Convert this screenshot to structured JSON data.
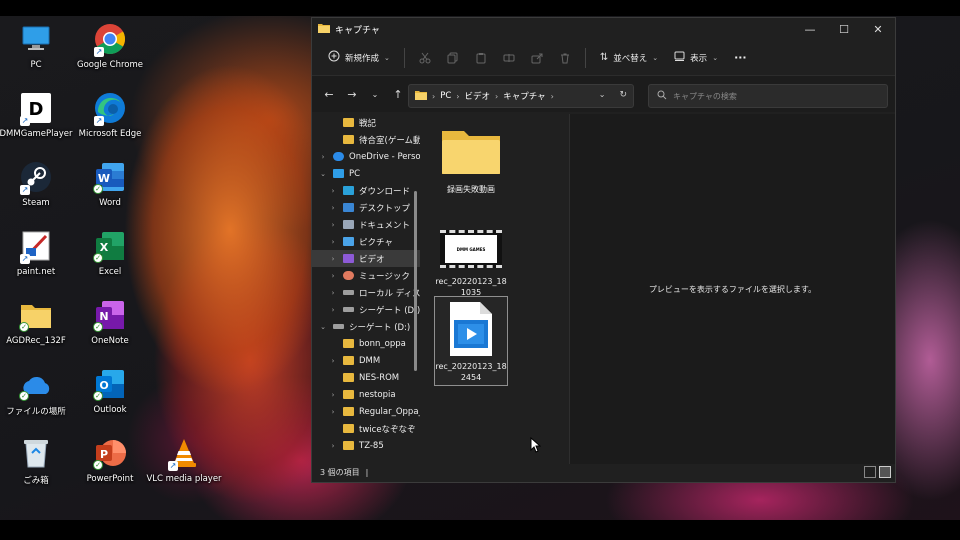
{
  "desktop": {
    "icons": [
      {
        "label": "PC",
        "icon": "pc-icon"
      },
      {
        "label": "Google Chrome",
        "icon": "chrome-icon"
      },
      {
        "label": "DMMGamePlayer",
        "icon": "dmm-icon"
      },
      {
        "label": "Microsoft Edge",
        "icon": "edge-icon"
      },
      {
        "label": "Steam",
        "icon": "steam-icon"
      },
      {
        "label": "Word",
        "icon": "word-icon"
      },
      {
        "label": "paint.net",
        "icon": "paintnet-icon"
      },
      {
        "label": "Excel",
        "icon": "excel-icon"
      },
      {
        "label": "AGDRec_132F",
        "icon": "folder-icon"
      },
      {
        "label": "OneNote",
        "icon": "onenote-icon"
      },
      {
        "label": "ファイルの場所",
        "icon": "onedrive-icon"
      },
      {
        "label": "Outlook",
        "icon": "outlook-icon"
      },
      {
        "label": "ごみ箱",
        "icon": "recycle-bin-icon"
      },
      {
        "label": "PowerPoint",
        "icon": "powerpoint-icon"
      },
      {
        "label": "VLC media player",
        "icon": "vlc-icon"
      }
    ]
  },
  "window": {
    "title": "キャプチャ",
    "controls": {
      "minimize": "—",
      "maximize": "☐",
      "close": "✕"
    }
  },
  "toolbar": {
    "new_label": "新規作成",
    "sort_label": "並べ替え",
    "view_label": "表示",
    "more_label": "···"
  },
  "address": {
    "crumbs": [
      "PC",
      "ビデオ",
      "キャプチャ"
    ]
  },
  "search": {
    "placeholder": "キャプチャの検索"
  },
  "navpane": {
    "items": [
      {
        "label": "戦記",
        "kind": "folder",
        "indent": 1,
        "expander": ""
      },
      {
        "label": "待合室(ゲーム動画",
        "kind": "folder",
        "indent": 1,
        "expander": ""
      },
      {
        "label": "OneDrive - Person",
        "kind": "onedrive",
        "indent": 0,
        "expander": "›"
      },
      {
        "label": "PC",
        "kind": "pc",
        "indent": 0,
        "expander": "⌄"
      },
      {
        "label": "ダウンロード",
        "kind": "download",
        "indent": 1,
        "expander": "›"
      },
      {
        "label": "デスクトップ",
        "kind": "desktop",
        "indent": 1,
        "expander": "›"
      },
      {
        "label": "ドキュメント",
        "kind": "document",
        "indent": 1,
        "expander": "›"
      },
      {
        "label": "ピクチャ",
        "kind": "picture",
        "indent": 1,
        "expander": "›"
      },
      {
        "label": "ビデオ",
        "kind": "video",
        "indent": 1,
        "expander": "›",
        "selected": true
      },
      {
        "label": "ミュージック",
        "kind": "music",
        "indent": 1,
        "expander": "›"
      },
      {
        "label": "ローカル ディスク (C",
        "kind": "disk",
        "indent": 1,
        "expander": "›"
      },
      {
        "label": "シーゲート (D:)",
        "kind": "disk",
        "indent": 1,
        "expander": "›"
      },
      {
        "label": "シーゲート (D:)",
        "kind": "disk",
        "indent": 0,
        "expander": "⌄"
      },
      {
        "label": "bonn_oppa",
        "kind": "folder",
        "indent": 1,
        "expander": ""
      },
      {
        "label": "DMM",
        "kind": "folder",
        "indent": 1,
        "expander": "›"
      },
      {
        "label": "NES-ROM",
        "kind": "folder",
        "indent": 1,
        "expander": ""
      },
      {
        "label": "nestopia",
        "kind": "folder",
        "indent": 1,
        "expander": "›"
      },
      {
        "label": "Regular_Oppa_V",
        "kind": "folder",
        "indent": 1,
        "expander": "›"
      },
      {
        "label": "twiceなぞなぞ",
        "kind": "folder",
        "indent": 1,
        "expander": ""
      },
      {
        "label": "TZ-85",
        "kind": "folder",
        "indent": 1,
        "expander": "›"
      }
    ]
  },
  "files": [
    {
      "name": "録画失敗動画",
      "type": "folder"
    },
    {
      "name": "rec_20220123_181035",
      "type": "video-thumb",
      "thumb_text": "DMM GAMES"
    },
    {
      "name": "rec_20220123_182454",
      "type": "video-file",
      "selected": true
    }
  ],
  "preview": {
    "message": "プレビューを表示するファイルを選択します。"
  },
  "status": {
    "count": "3 個の項目",
    "sep": "|"
  }
}
